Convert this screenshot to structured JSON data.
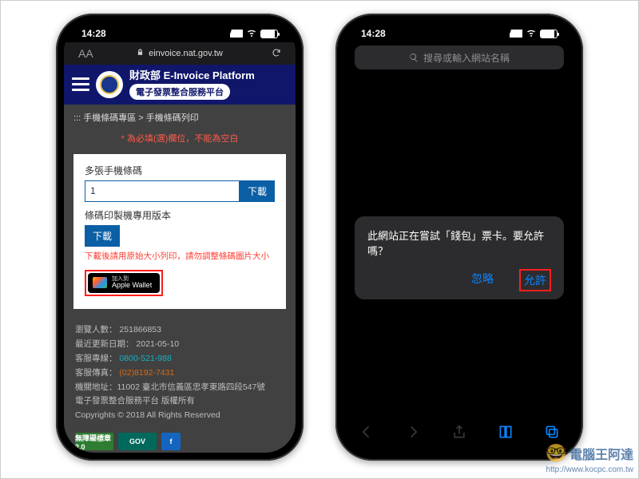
{
  "status": {
    "time": "14:28"
  },
  "left": {
    "addressbar": {
      "domain": "einvoice.nat.gov.tw"
    },
    "nav": {
      "title_line1": "財政部 E-Invoice Platform",
      "title_pill": "電子發票整合服務平台"
    },
    "breadcrumb": "::: 手機條碼專區 > 手機條碼列印",
    "required_note": "* 為必填(選)欄位，不能為空白",
    "form": {
      "multi_label": "多張手機條碼",
      "multi_value": "1",
      "multi_download": "下載",
      "printer_label": "條碼印製機專用版本",
      "printer_download": "下載",
      "resize_hint": "下載後請用原始大小列印，請勿調整條碼圖片大小",
      "wallet_small": "加入到",
      "wallet_main": "Apple Wallet"
    },
    "footer": {
      "visits_label": "瀏覽人數：",
      "visits_value": "251866853",
      "updated_label": "最近更新日期：",
      "updated_value": "2021-05-10",
      "hotline_label": "客服專線：",
      "hotline_value": "0800-521-988",
      "fax_label": "客服傳真：",
      "fax_value": "(02)8192-7431",
      "address_label": "機關地址：",
      "address_value": "11002 臺北市信義區忠孝東路四段547號",
      "owner": "電子發票整合服務平台 版權所有",
      "copyright": "Copyrights © 2018 All Rights Reserved"
    },
    "badges": {
      "b1": "無障礙標章2.0",
      "b2": "GOV",
      "b3": "f"
    }
  },
  "right": {
    "search_placeholder": "搜尋或輸入網站名稱",
    "dialog": {
      "message": "此網站正在嘗試「錢包」票卡。要允許嗎？",
      "ignore": "忽略",
      "allow": "允許"
    }
  },
  "watermark": {
    "name": "電腦王阿達",
    "url": "http://www.kocpc.com.tw"
  }
}
